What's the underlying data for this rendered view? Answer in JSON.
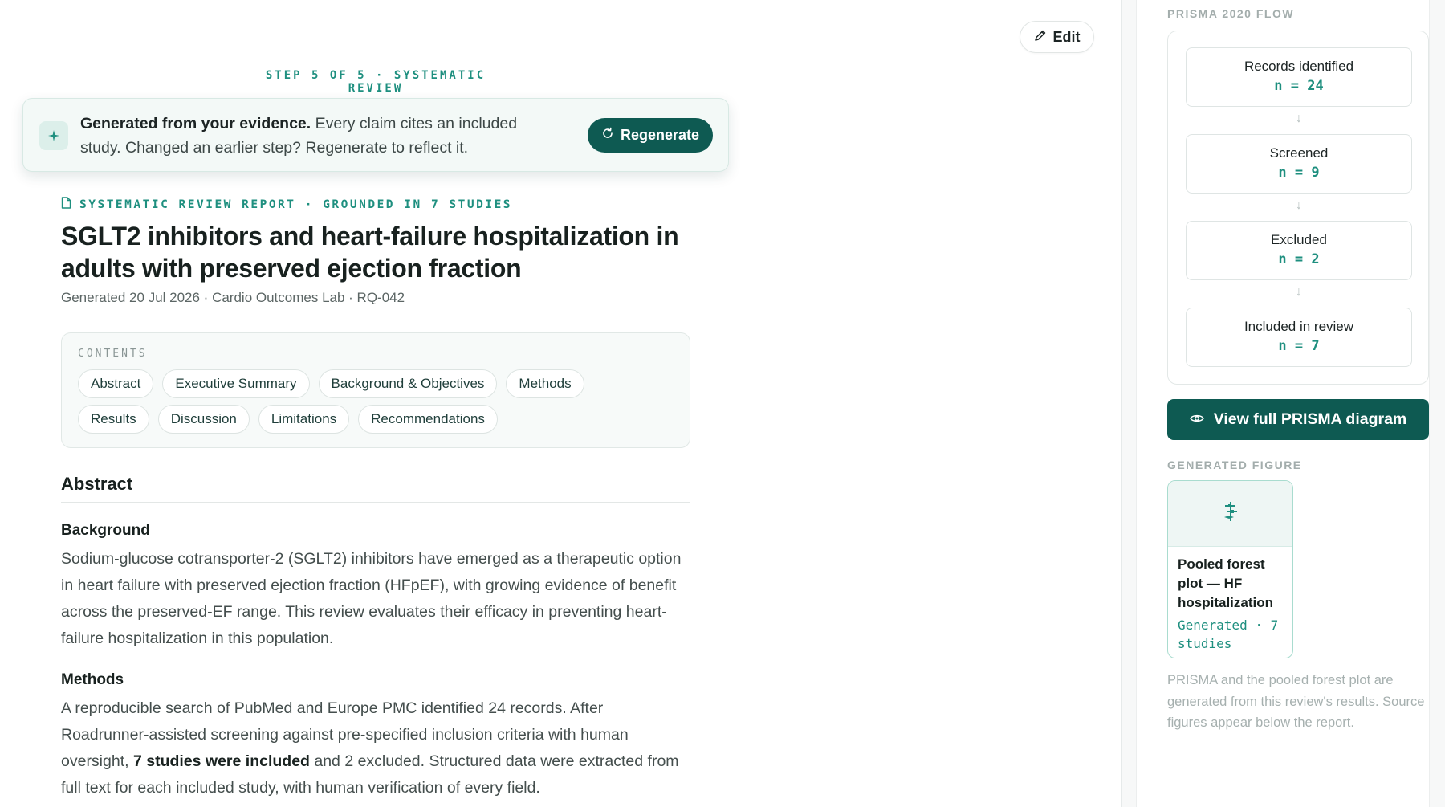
{
  "toolbar": {
    "edit_label": "Edit"
  },
  "step_label": "STEP 5 OF 5 · SYSTEMATIC REVIEW",
  "banner": {
    "bold": "Generated from your evidence.",
    "text": " Every claim cites an included study. Changed an earlier step? Regenerate to reflect it.",
    "button_label": "Regenerate"
  },
  "report": {
    "kicker": "SYSTEMATIC REVIEW REPORT · GROUNDED IN 7 STUDIES",
    "title": "SGLT2 inhibitors and heart-failure hospitalization in adults with preserved ejection fraction",
    "meta": "Generated 20 Jul 2026 · Cardio Outcomes Lab · RQ-042"
  },
  "contents": {
    "label": "CONTENTS",
    "row1": [
      "Abstract",
      "Executive Summary",
      "Background & Objectives",
      "Methods"
    ],
    "row2": [
      "Results",
      "Discussion",
      "Limitations",
      "Recommendations"
    ]
  },
  "abstract": {
    "heading": "Abstract",
    "background_heading": "Background",
    "background_text": "Sodium-glucose cotransporter-2 (SGLT2) inhibitors have emerged as a therapeutic option in heart failure with preserved ejection fraction (HFpEF), with growing evidence of benefit across the preserved-EF range. This review evaluates their efficacy in preventing heart-failure hospitalization in this population.",
    "methods_heading": "Methods",
    "methods_text_1": "A reproducible search of PubMed and Europe PMC identified 24 records. After Roadrunner-assisted screening against pre-specified inclusion criteria with human oversight, ",
    "methods_bold": "7 studies were included",
    "methods_text_2": " and 2 excluded. Structured data were extracted from full text for each included study, with human verification of every field."
  },
  "sidebar": {
    "prisma_label": "PRISMA 2020 FLOW",
    "prisma_steps": [
      {
        "label": "Records identified",
        "n": "n = 24"
      },
      {
        "label": "Screened",
        "n": "n = 9"
      },
      {
        "label": "Excluded",
        "n": "n = 2"
      },
      {
        "label": "Included in review",
        "n": "n = 7"
      }
    ],
    "prisma_button": "View full PRISMA diagram",
    "figure_label": "GENERATED FIGURE",
    "figure_title": "Pooled forest plot — HF hospitalization",
    "figure_sub": "Generated · 7 studies",
    "note": "PRISMA and the pooled forest plot are generated from this review's results. Source figures appear below the report."
  },
  "colors": {
    "accent": "#0e5a52",
    "teal": "#1e8f7f"
  },
  "icons": [
    "pencil-icon",
    "sparkle-icon",
    "refresh-icon",
    "document-icon",
    "eye-icon",
    "forest-plot-icon",
    "arrow-down-icon"
  ]
}
